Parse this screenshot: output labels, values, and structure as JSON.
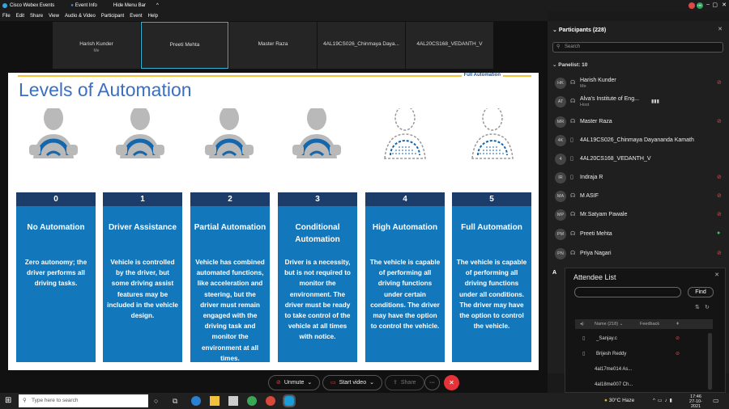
{
  "titlebar": {
    "app": "Cisco Webex Events",
    "event_info": "Event Info",
    "hide_menu": "Hide Menu Bar",
    "avatar": "HK"
  },
  "menu": [
    "File",
    "Edit",
    "Share",
    "View",
    "Audio & Video",
    "Participant",
    "Event",
    "Help"
  ],
  "tiles": [
    {
      "name": "Harish Kunder",
      "sub": "Me"
    },
    {
      "name": "Preeti Mehta"
    },
    {
      "name": "Master Raza"
    },
    {
      "name": "4AL19CS026_Chinmaya Daya..."
    },
    {
      "name": "4AL20CS168_VEDANTH_V"
    }
  ],
  "slide": {
    "title": "Levels of Automation",
    "banner": "Full Automation",
    "levels": [
      {
        "num": "0",
        "title": "No Automation",
        "desc": "Zero autonomy; the driver performs all driving tasks."
      },
      {
        "num": "1",
        "title": "Driver Assistance",
        "desc": "Vehicle is controlled by the driver, but some driving assist features may be included in the vehicle design."
      },
      {
        "num": "2",
        "title": "Partial Automation",
        "desc": "Vehicle has combined automated functions, like acceleration and steering, but the driver must remain engaged with the driving task and monitor the environment at all times."
      },
      {
        "num": "3",
        "title": "Conditional Automation",
        "desc": "Driver is a necessity, but is not required to monitor the environment. The driver must be ready to take control of the vehicle at all times with notice."
      },
      {
        "num": "4",
        "title": "High Automation",
        "desc": "The vehicle is capable of performing all driving functions under certain conditions. The driver may have the option to control the vehicle."
      },
      {
        "num": "5",
        "title": "Full Automation",
        "desc": "The vehicle is capable of performing all driving functions under all conditions. The driver may have the option to control the vehicle."
      }
    ]
  },
  "participants": {
    "header": "Participants (228)",
    "search_placeholder": "Search",
    "panelist_label": "Panelist: 10",
    "list": [
      {
        "initials": "HK",
        "name": "Harish Kunder",
        "role": "Me"
      },
      {
        "initials": "AT",
        "name": "Alva's Institute of Eng...",
        "role": "Host"
      },
      {
        "initials": "MR",
        "name": "Master Raza"
      },
      {
        "initials": "4K",
        "name": "4AL19CS026_Chinmaya Dayananda Kamath"
      },
      {
        "initials": "4",
        "name": "4AL20CS168_VEDANTH_V"
      },
      {
        "initials": "IR",
        "name": "Indraja R"
      },
      {
        "initials": "MA",
        "name": "M ASIF"
      },
      {
        "initials": "MP",
        "name": "Mr.Satyam Pawale"
      },
      {
        "initials": "PM",
        "name": "Preeti Mehta"
      },
      {
        "initials": "PN",
        "name": "Priya Nagari"
      }
    ],
    "next_section": "A"
  },
  "attendee": {
    "title": "Attendee List",
    "find": "Find",
    "col_name": "Name (218)",
    "col_feedback": "Feedback",
    "rows": [
      "_Sanjay.c",
      "Brijesh Reddy",
      "4al17me014 As...",
      "4al18me007 Ch..."
    ]
  },
  "controls": {
    "unmute": "Unmute",
    "start_video": "Start video",
    "share": "Share",
    "more": "···"
  },
  "taskbar": {
    "search_placeholder": "Type here to search",
    "weather": "30°C  Haze",
    "time": "17:46",
    "date": "27-10-2021"
  },
  "colors": {
    "slide_blue": "#1377bc",
    "dark_navy": "#1c3c6a",
    "title_blue": "#3b6fc4",
    "end_red": "#e5333a"
  }
}
